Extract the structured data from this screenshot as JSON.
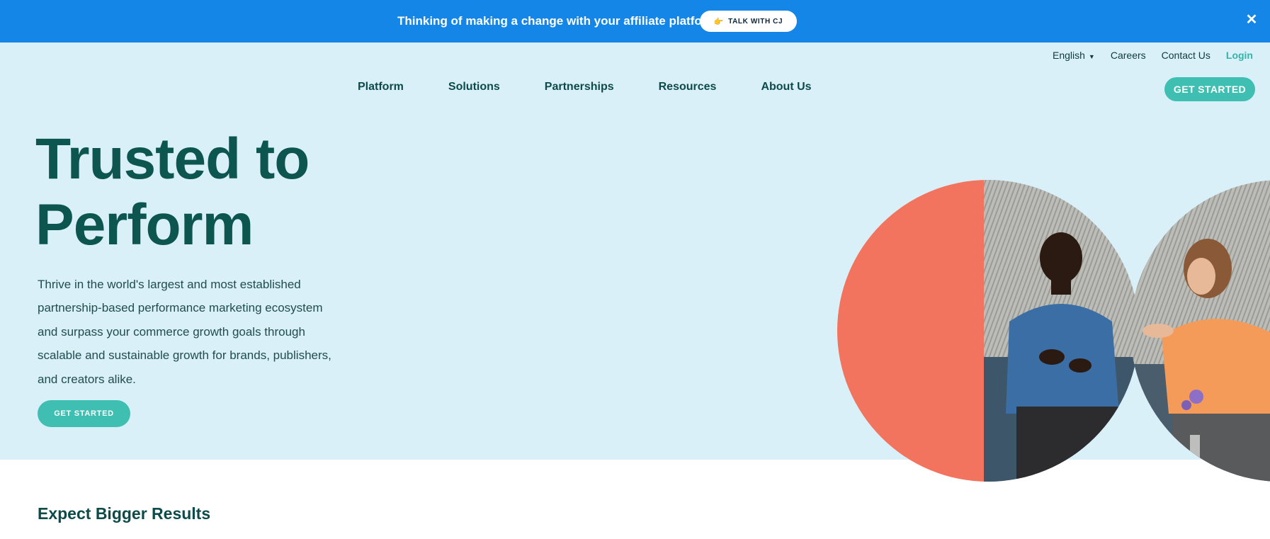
{
  "banner": {
    "message": "Thinking of making a change with your affiliate platform?",
    "cta_icon": "pointing-hand-icon",
    "cta_emoji": "👉",
    "cta_label": "TALK WITH CJ",
    "close_icon": "close-icon",
    "close_glyph": "✕",
    "color": "#1386e8"
  },
  "utility_nav": {
    "language": "English",
    "language_caret": "▼",
    "items": [
      "Careers",
      "Contact Us"
    ],
    "login": "Login"
  },
  "main_nav": {
    "items": [
      "Platform",
      "Solutions",
      "Partnerships",
      "Resources",
      "About Us"
    ],
    "cta": "GET STARTED"
  },
  "hero": {
    "headline_line1": "Trusted to",
    "headline_line2": "Perform",
    "lede": "Thrive in the world's largest and most established partnership-based performance marketing ecosystem and surpass your commerce growth goals through scalable and sustainable growth for brands, publishers, and creators alike.",
    "cta": "GET STARTED",
    "background": "#daf0f8",
    "accent": "#3ebfb2",
    "art_colors": {
      "coral": "#f2745e",
      "teal_dark": "#0d5650"
    }
  },
  "section": {
    "title": "Expect Bigger Results"
  }
}
